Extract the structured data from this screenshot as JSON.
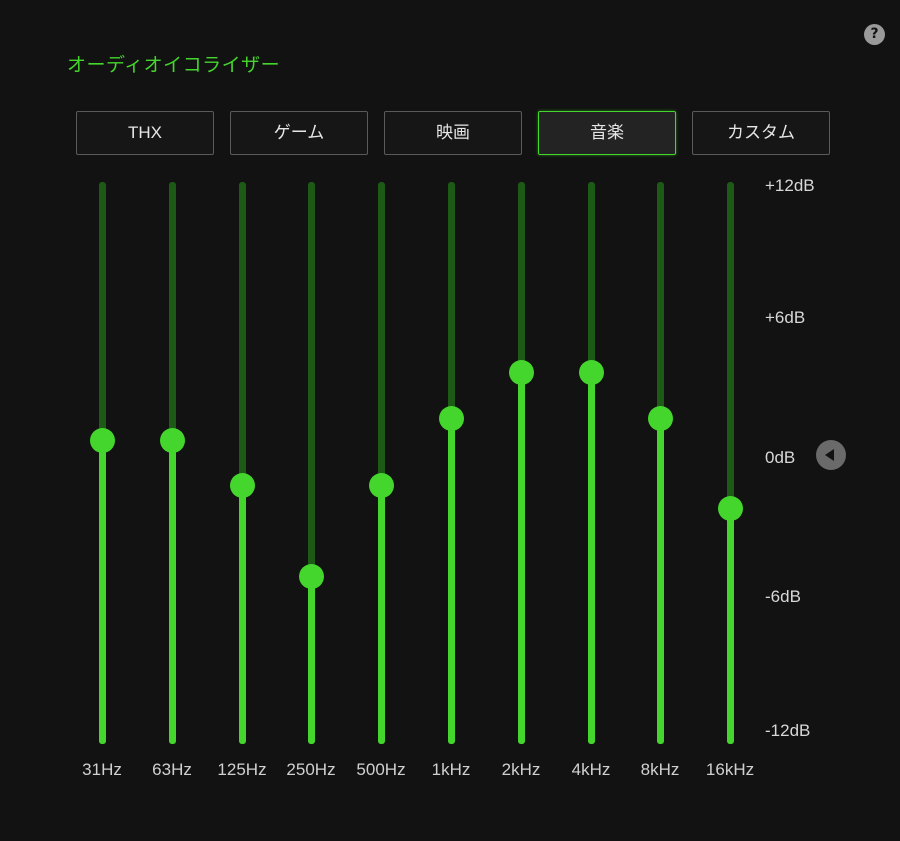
{
  "header": {
    "title": "オーディオイコライザー",
    "help_glyph": "?"
  },
  "presets": [
    {
      "label": "THX",
      "selected": false
    },
    {
      "label": "ゲーム",
      "selected": false
    },
    {
      "label": "映画",
      "selected": false
    },
    {
      "label": "音楽",
      "selected": true
    },
    {
      "label": "カスタム",
      "selected": false
    }
  ],
  "db_scale": {
    "labels": [
      "+12dB",
      "+6dB",
      "0dB",
      "-6dB",
      "-12dB"
    ],
    "values": [
      12,
      6,
      0,
      -6,
      -12
    ]
  },
  "bands": [
    {
      "freq": "31Hz",
      "gain_db": 0.7
    },
    {
      "freq": "63Hz",
      "gain_db": 0.7
    },
    {
      "freq": "125Hz",
      "gain_db": -1.3
    },
    {
      "freq": "250Hz",
      "gain_db": -5.3
    },
    {
      "freq": "500Hz",
      "gain_db": -1.3
    },
    {
      "freq": "1kHz",
      "gain_db": 1.7
    },
    {
      "freq": "2kHz",
      "gain_db": 3.7
    },
    {
      "freq": "4kHz",
      "gain_db": 3.7
    },
    {
      "freq": "8kHz",
      "gain_db": 1.7
    },
    {
      "freq": "16kHz",
      "gain_db": -2.3
    }
  ],
  "colors": {
    "accent": "#44d62c",
    "track_dim": "#1d5a16",
    "background": "#121212"
  }
}
